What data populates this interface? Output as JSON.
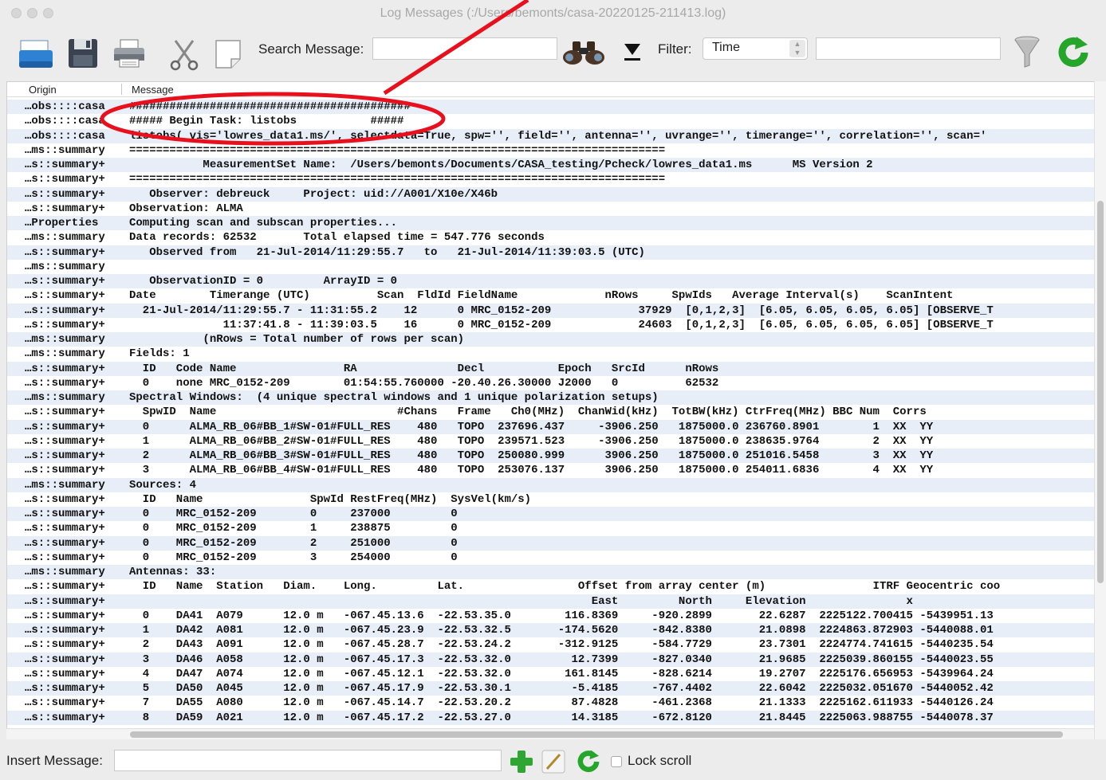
{
  "window": {
    "title": "Log Messages (:/Users/bemonts/casa-20220125-211413.log)"
  },
  "toolbar": {
    "icons": [
      "open-icon",
      "save-icon",
      "print-icon",
      "cut-icon",
      "copy-icon",
      "binoculars-icon",
      "find-next-icon",
      "funnel-icon",
      "refresh-icon"
    ],
    "search_label": "Search Message:",
    "search_value": "",
    "filter_label": "Filter:",
    "filter_value": "Time",
    "filter_text_value": ""
  },
  "columns": {
    "origin": "Origin",
    "message": "Message"
  },
  "rows": [
    {
      "origin": "…obs::::casa",
      "message": "##########################################"
    },
    {
      "origin": "…obs::::casa",
      "message": "##### Begin Task: listobs           #####"
    },
    {
      "origin": "…obs::::casa",
      "message": "listobs( vis='lowres_data1.ms/', selectdata=True, spw='', field='', antenna='', uvrange='', timerange='', correlation='', scan='"
    },
    {
      "origin": "…ms::summary",
      "message": "================================================================================"
    },
    {
      "origin": "…s::summary+",
      "message": "           MeasurementSet Name:  /Users/bemonts/Documents/CASA_testing/Pcheck/lowres_data1.ms      MS Version 2"
    },
    {
      "origin": "…s::summary+",
      "message": "================================================================================"
    },
    {
      "origin": "…s::summary+",
      "message": "   Observer: debreuck     Project: uid://A001/X10e/X46b"
    },
    {
      "origin": "…s::summary+",
      "message": "Observation: ALMA"
    },
    {
      "origin": "…Properties",
      "message": "Computing scan and subscan properties..."
    },
    {
      "origin": "…ms::summary",
      "message": "Data records: 62532       Total elapsed time = 547.776 seconds"
    },
    {
      "origin": "…s::summary+",
      "message": "   Observed from   21-Jul-2014/11:29:55.7   to   21-Jul-2014/11:39:03.5 (UTC)"
    },
    {
      "origin": "…ms::summary",
      "message": ""
    },
    {
      "origin": "…s::summary+",
      "message": "   ObservationID = 0         ArrayID = 0"
    },
    {
      "origin": "…s::summary+",
      "message": "Date        Timerange (UTC)          Scan  FldId FieldName             nRows     SpwIds   Average Interval(s)    ScanIntent"
    },
    {
      "origin": "…s::summary+",
      "message": "  21-Jul-2014/11:29:55.7 - 11:31:55.2    12      0 MRC_0152-209             37929  [0,1,2,3]  [6.05, 6.05, 6.05, 6.05] [OBSERVE_T"
    },
    {
      "origin": "…s::summary+",
      "message": "              11:37:41.8 - 11:39:03.5    16      0 MRC_0152-209             24603  [0,1,2,3]  [6.05, 6.05, 6.05, 6.05] [OBSERVE_T"
    },
    {
      "origin": "…ms::summary",
      "message": "           (nRows = Total number of rows per scan)"
    },
    {
      "origin": "…ms::summary",
      "message": "Fields: 1"
    },
    {
      "origin": "…s::summary+",
      "message": "  ID   Code Name                RA               Decl           Epoch   SrcId      nRows"
    },
    {
      "origin": "…s::summary+",
      "message": "  0    none MRC_0152-209        01:54:55.760000 -20.40.26.30000 J2000   0          62532"
    },
    {
      "origin": "…ms::summary",
      "message": "Spectral Windows:  (4 unique spectral windows and 1 unique polarization setups)"
    },
    {
      "origin": "…s::summary+",
      "message": "  SpwID  Name                           #Chans   Frame   Ch0(MHz)  ChanWid(kHz)  TotBW(kHz) CtrFreq(MHz) BBC Num  Corrs"
    },
    {
      "origin": "…s::summary+",
      "message": "  0      ALMA_RB_06#BB_1#SW-01#FULL_RES    480   TOPO  237696.437     -3906.250   1875000.0 236760.8901        1  XX  YY"
    },
    {
      "origin": "…s::summary+",
      "message": "  1      ALMA_RB_06#BB_2#SW-01#FULL_RES    480   TOPO  239571.523     -3906.250   1875000.0 238635.9764        2  XX  YY"
    },
    {
      "origin": "…s::summary+",
      "message": "  2      ALMA_RB_06#BB_3#SW-01#FULL_RES    480   TOPO  250080.999      3906.250   1875000.0 251016.5458        3  XX  YY"
    },
    {
      "origin": "…s::summary+",
      "message": "  3      ALMA_RB_06#BB_4#SW-01#FULL_RES    480   TOPO  253076.137      3906.250   1875000.0 254011.6836        4  XX  YY"
    },
    {
      "origin": "…ms::summary",
      "message": "Sources: 4"
    },
    {
      "origin": "…s::summary+",
      "message": "  ID   Name                SpwId RestFreq(MHz)  SysVel(km/s)"
    },
    {
      "origin": "…s::summary+",
      "message": "  0    MRC_0152-209        0     237000         0"
    },
    {
      "origin": "…s::summary+",
      "message": "  0    MRC_0152-209        1     238875         0"
    },
    {
      "origin": "…s::summary+",
      "message": "  0    MRC_0152-209        2     251000         0"
    },
    {
      "origin": "…s::summary+",
      "message": "  0    MRC_0152-209        3     254000         0"
    },
    {
      "origin": "…ms::summary",
      "message": "Antennas: 33:"
    },
    {
      "origin": "…s::summary+",
      "message": "  ID   Name  Station   Diam.    Long.         Lat.                 Offset from array center (m)                ITRF Geocentric coo"
    },
    {
      "origin": "…s::summary+",
      "message": "                                                                     East         North     Elevation               x"
    },
    {
      "origin": "…s::summary+",
      "message": "  0    DA41  A079      12.0 m   -067.45.13.6  -22.53.35.0        116.8369     -920.2899       22.6287  2225122.700415 -5439951.13"
    },
    {
      "origin": "…s::summary+",
      "message": "  1    DA42  A081      12.0 m   -067.45.23.9  -22.53.32.5       -174.5620     -842.8380       21.0898  2224863.872903 -5440088.01"
    },
    {
      "origin": "…s::summary+",
      "message": "  2    DA43  A091      12.0 m   -067.45.28.7  -22.53.24.2       -312.9125     -584.7729       23.7301  2224774.741615 -5440235.54"
    },
    {
      "origin": "…s::summary+",
      "message": "  3    DA46  A058      12.0 m   -067.45.17.3  -22.53.32.0         12.7399     -827.0340       21.9685  2225039.860155 -5440023.55"
    },
    {
      "origin": "…s::summary+",
      "message": "  4    DA47  A074      12.0 m   -067.45.12.1  -22.53.32.0        161.8145     -828.6214       19.2707  2225176.656953 -5439964.24"
    },
    {
      "origin": "…s::summary+",
      "message": "  5    DA50  A045      12.0 m   -067.45.17.9  -22.53.30.1         -5.4185     -767.4402       22.6042  2225032.051670 -5440052.42"
    },
    {
      "origin": "…s::summary+",
      "message": "  7    DA55  A080      12.0 m   -067.45.14.7  -22.53.20.2         87.4828     -461.2368       21.1333  2225162.611933 -5440126.24"
    },
    {
      "origin": "…s::summary+",
      "message": "  8    DA59  A021      12.0 m   -067.45.17.2  -22.53.27.0         14.3185     -672.8120       21.8445  2225063.988755 -5440078.37"
    }
  ],
  "bottom": {
    "insert_label": "Insert Message:",
    "insert_value": "",
    "lock_label": "Lock scroll",
    "lock_checked": false,
    "icons": [
      "add-message-icon",
      "edit-icon",
      "refresh-icon"
    ]
  },
  "annotation": {
    "color": "#e8101c"
  }
}
